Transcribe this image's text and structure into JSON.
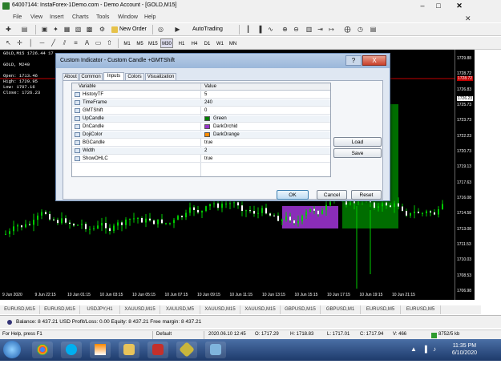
{
  "window": {
    "title": "64007144: InstaForex-1Demo.com - Demo Account - [GOLD,M15]"
  },
  "menu": [
    "File",
    "View",
    "Insert",
    "Charts",
    "Tools",
    "Window",
    "Help"
  ],
  "toolbar": {
    "new_order": "New Order",
    "autotrading": "AutoTrading",
    "timeframes": [
      "M1",
      "M5",
      "M15",
      "M30",
      "H1",
      "H4",
      "D1",
      "W1",
      "MN"
    ],
    "active_timeframe": "M30"
  },
  "chart": {
    "symbol_header": "GOLD,M15  1726.44 17",
    "sub_header": "GOLD, M240",
    "ohlc": [
      {
        "label": "Open:",
        "value": "1713.46"
      },
      {
        "label": "High:",
        "value": "1729.95"
      },
      {
        "label": "Low:",
        "value": "1707.16"
      },
      {
        "label": "Close:",
        "value": "1726.23"
      }
    ],
    "price_ticks": [
      "1729.88",
      "1728.72",
      "1726.83",
      "1725.73",
      "1723.73",
      "1722.23",
      "1720.73",
      "1719.13",
      "1717.63",
      "1716.08",
      "1714.58",
      "1713.08",
      "1711.53",
      "1710.03",
      "1708.53",
      "1706.98"
    ],
    "bid_label": "1728.72",
    "current_label": "1726.23",
    "time_ticks": [
      "9 Jun 2020",
      "9 Jun 22:15",
      "10 Jun 01:15",
      "10 Jun 03:15",
      "10 Jun 05:15",
      "10 Jun 07:15",
      "10 Jun 09:15",
      "10 Jun 11:15",
      "10 Jun 13:15",
      "10 Jun 15:15",
      "10 Jun 17:15",
      "10 Jun 19:15",
      "10 Jun 21:15"
    ]
  },
  "chart_tabs": [
    "EURUSD,M15",
    "EURUSD,M15",
    "USDJPY,H1",
    "XAUUSD,M15",
    "XAUUSD,M5",
    "XAUUSD,M15",
    "XAUUSD,M15",
    "GBPUSD,M15",
    "GBPUSD,M1",
    "EURUSD,M5",
    "EURUSD,M5"
  ],
  "terminal": {
    "balance_line": "Balance: 8 437.21 USD  Profit/Loss: 0.00  Equity: 8 437.21  Free margin: 8 437.21"
  },
  "statusbar": {
    "help": "For Help, press F1",
    "profile": "Default",
    "datetime": "2020.06.10 12:45",
    "open": "O: 1717.29",
    "high": "H: 1718.83",
    "low": "L: 1717.01",
    "close": "C: 1717.94",
    "volume": "V: 466",
    "traffic": "8752/5 kb"
  },
  "taskbar": {
    "time": "11:35 PM",
    "date": "6/10/2020"
  },
  "dialog": {
    "title": "Custom Indicator - Custom Candle +GMTShift",
    "help_button": "?",
    "close_button": "X",
    "tabs": [
      "About",
      "Common",
      "Inputs",
      "Colors",
      "Visualization"
    ],
    "active_tab": "Inputs",
    "columns": [
      "Variable",
      "Value"
    ],
    "rows": [
      {
        "name": "HistoryTF",
        "value": "5"
      },
      {
        "name": "TimeFrame",
        "value": "240"
      },
      {
        "name": "GMTShift",
        "value": "0"
      },
      {
        "name": "UpCandle",
        "value": "Green",
        "swatch": "#008000"
      },
      {
        "name": "DnCandle",
        "value": "DarkOrchid",
        "swatch": "#9932cc"
      },
      {
        "name": "DojiColor",
        "value": "DarkOrange",
        "swatch": "#ff8c00"
      },
      {
        "name": "BGCandle",
        "value": "true"
      },
      {
        "name": "Width",
        "value": "2"
      },
      {
        "name": "ShowOHLC",
        "value": "true"
      }
    ],
    "load_button": "Load",
    "save_button": "Save",
    "ok_button": "OK",
    "cancel_button": "Cancel",
    "reset_button": "Reset"
  },
  "colors": {
    "bull": "#00cc00",
    "bear": "#9932cc",
    "bull_bg": "#008000",
    "bid_line": "#c00000"
  }
}
